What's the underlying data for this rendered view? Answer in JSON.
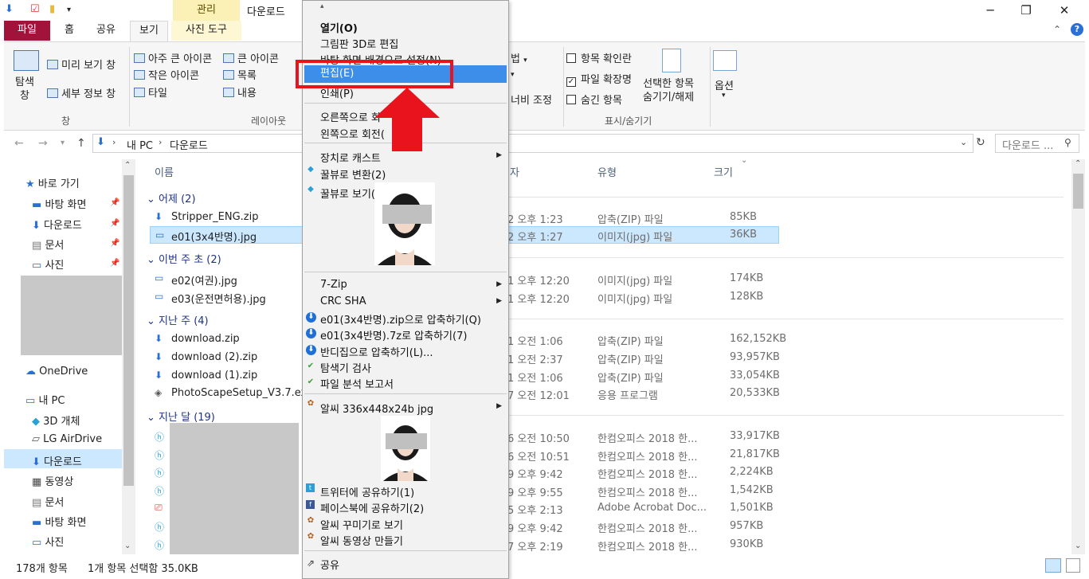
{
  "window": {
    "context_tab": "관리",
    "title": "다운로드",
    "min": "─",
    "max": "❐",
    "close": "✕"
  },
  "tabs": [
    "파일",
    "홈",
    "공유",
    "보기",
    "사진 도구"
  ],
  "ribbon": {
    "preview_pane": "미리 보기 창",
    "details_pane": "세부 정보 창",
    "nav_pane": "탐색\n창",
    "pane_group": "창",
    "layout": {
      "xlarge": "아주 큰 아이콘",
      "large": "큰 아이콘",
      "small": "작은 아이콘",
      "list": "목록",
      "tiles": "타일",
      "content": "내용"
    },
    "layout_group": "레이아웃",
    "sort_fragment": "법",
    "width_fragment": "너비 조정",
    "checks": {
      "item_check": "항목 확인란",
      "file_ext": "파일 확장명",
      "hidden": "숨긴 항목"
    },
    "hide_selected": "선택한 항목\n숨기기/해제",
    "options": "옵션",
    "showhide_group": "표시/숨기기"
  },
  "address": {
    "crumbs": [
      "내 PC",
      "다운로드"
    ],
    "search_placeholder": "다운로드 ..."
  },
  "nav": {
    "quick": "바로 가기",
    "desktop": "바탕 화면",
    "downloads": "다운로드",
    "docs": "문서",
    "pictures": "사진",
    "onedrive": "OneDrive",
    "mypc": "내 PC",
    "objects3d": "3D 개체",
    "airdrive": "LG AirDrive",
    "downloads2": "다운로드",
    "videos": "동영상",
    "docs2": "문서",
    "desktop2": "바탕 화면",
    "pictures2": "사진"
  },
  "columns": {
    "name": "이름",
    "date": "자",
    "type": "유형",
    "size": "크기"
  },
  "groups": {
    "yesterday": "어제 (2)",
    "thisweek": "이번 주 초 (2)",
    "lastweek": "지난 주 (4)",
    "lastmonth": "지난 달 (19)"
  },
  "files": [
    {
      "name": "Stripper_ENG.zip",
      "date": "2 오후 1:23",
      "type": "압축(ZIP) 파일",
      "size": "85KB"
    },
    {
      "name": "e01(3x4반명).jpg",
      "date": "2 오후 1:27",
      "type": "이미지(jpg) 파일",
      "size": "36KB"
    },
    {
      "name": "e02(여권).jpg",
      "date": "1 오후 12:20",
      "type": "이미지(jpg) 파일",
      "size": "174KB"
    },
    {
      "name": "e03(운전면허용).jpg",
      "date": "1 오후 12:20",
      "type": "이미지(jpg) 파일",
      "size": "128KB"
    },
    {
      "name": "download.zip",
      "date": "1 오전 1:06",
      "type": "압축(ZIP) 파일",
      "size": "162,152KB"
    },
    {
      "name": "download (2).zip",
      "date": "1 오전 2:37",
      "type": "압축(ZIP) 파일",
      "size": "93,957KB"
    },
    {
      "name": "download (1).zip",
      "date": "1 오전 1:06",
      "type": "압축(ZIP) 파일",
      "size": "33,054KB"
    },
    {
      "name": "PhotoScapeSetup_V3.7.exe",
      "date": "7 오전 12:01",
      "type": "응용 프로그램",
      "size": "20,533KB"
    },
    {
      "name": "",
      "date": "6 오전 10:50",
      "type": "한컴오피스 2018 한...",
      "size": "33,917KB"
    },
    {
      "name": "",
      "date": "6 오전 10:51",
      "type": "한컴오피스 2018 한...",
      "size": "21,817KB"
    },
    {
      "name": "",
      "date": "9 오후 9:42",
      "type": "한컴오피스 2018 한...",
      "size": "2,224KB"
    },
    {
      "name": "",
      "date": "9 오후 9:55",
      "type": "한컴오피스 2018 한...",
      "size": "1,542KB"
    },
    {
      "name": "",
      "date": "5 오후 2:13",
      "type": "Adobe Acrobat Doc...",
      "size": "1,501KB"
    },
    {
      "name": "",
      "date": "9 오후 9:42",
      "type": "한컴오피스 2018 한...",
      "size": "957KB"
    },
    {
      "name": "",
      "date": "7 오후 2:19",
      "type": "한컴오피스 2018 한...",
      "size": "930KB"
    }
  ],
  "status": {
    "count": "178개 항목",
    "selected": "1개 항목 선택함 35.0KB"
  },
  "menu": {
    "open": "열기(O)",
    "paint3d": "그림판 3D로 편집",
    "wallpaper": "바탕 화면 배경으로 설정(N)",
    "edit": "편집(E)",
    "print": "인쇄(P)",
    "rotate_right": "오른쪽으로 회",
    "rotate_left": "왼쪽으로 회전(",
    "cast": "장치로 캐스트",
    "honeyview_convert": "꿀뷰로 변환(2)",
    "honeyview_view": "꿀뷰로 보기(3)",
    "zip7": "7-Zip",
    "crc": "CRC SHA",
    "zip_bandizip": "e01(3x4반명).zip으로 압축하기(Q)",
    "zip_7z": "e01(3x4반명).7z로 압축하기(7)",
    "bandizip": "반디집으로 압축하기(L)...",
    "explorer_scan": "탐색기 검사",
    "file_report": "파일 분석 보고서",
    "alsee": "알씨 336x448x24b jpg",
    "twitter": "트위터에 공유하기(1)",
    "facebook": "페이스북에 공유하기(2)",
    "alsee_decorate": "알씨 꾸미기로 보기",
    "alsee_video": "알씨 동영상 만들기",
    "share": "공유"
  }
}
